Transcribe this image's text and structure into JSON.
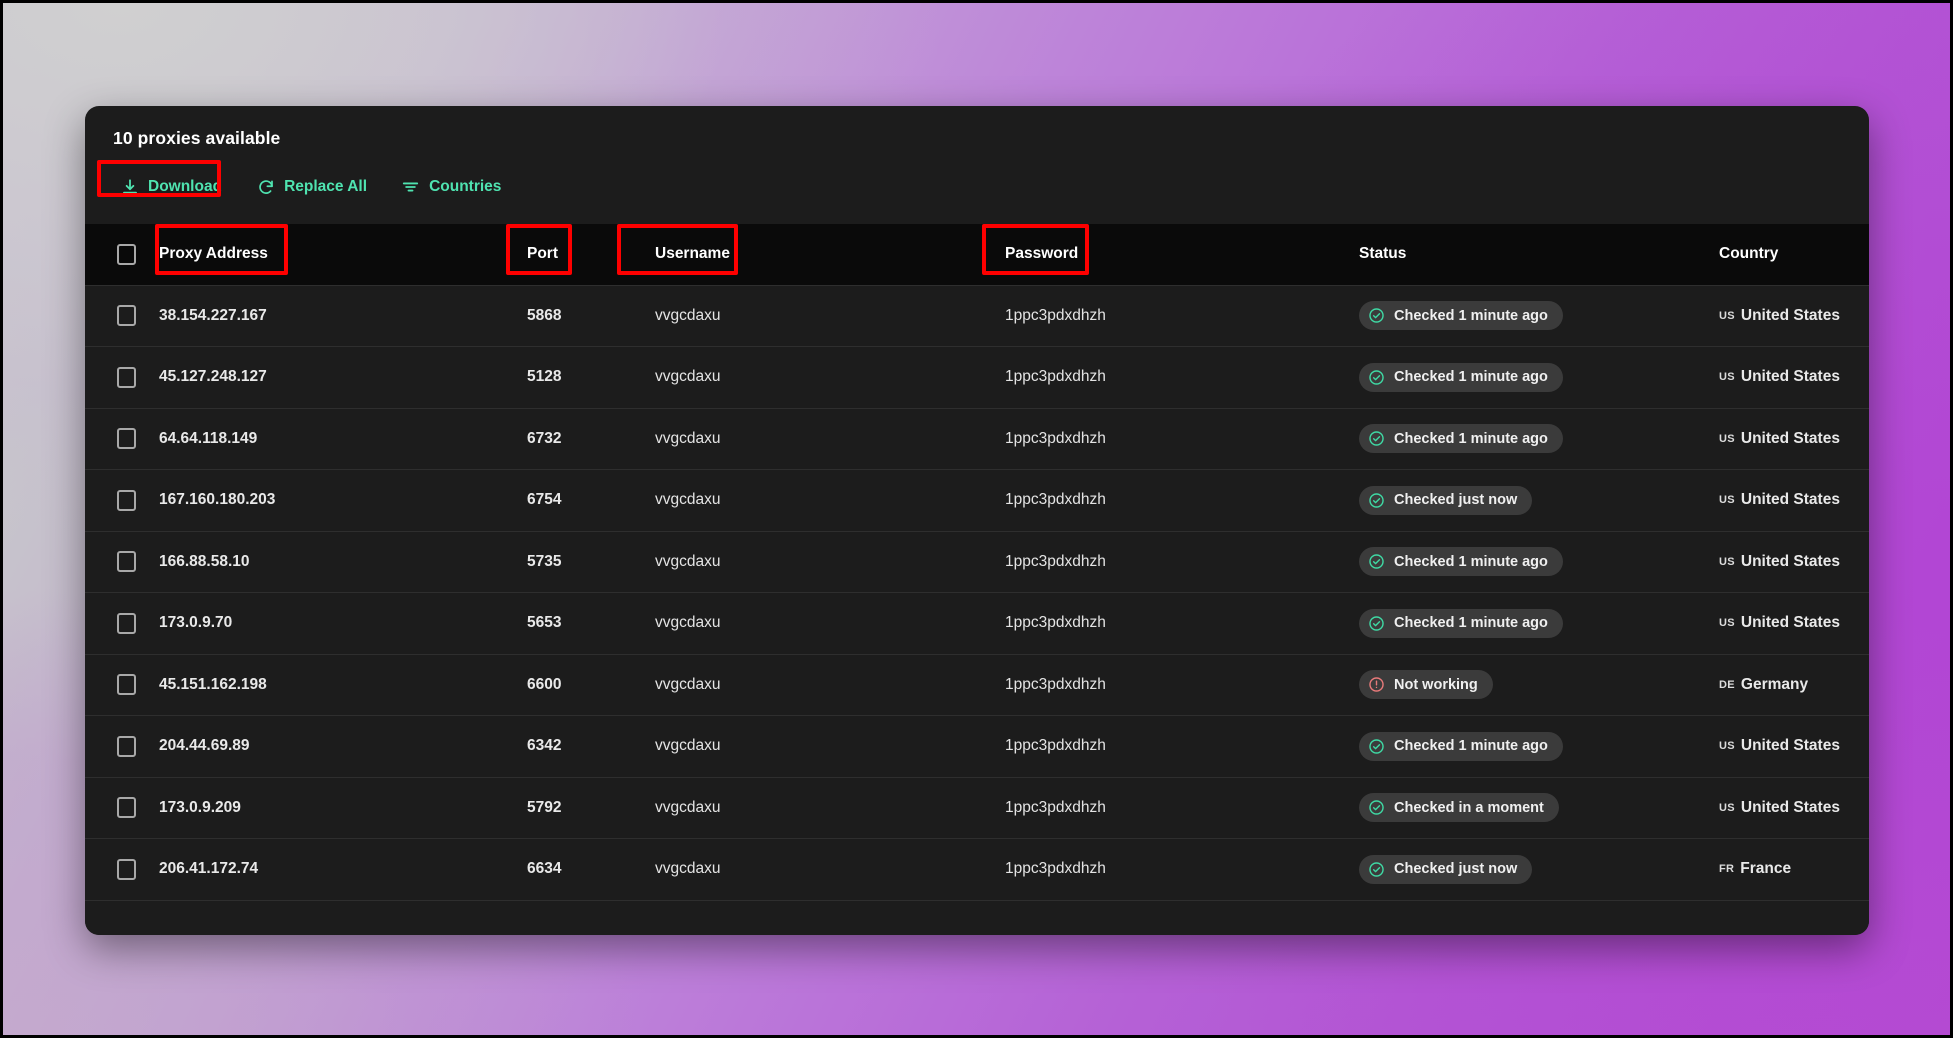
{
  "card": {
    "title": "10 proxies available",
    "toolbar": [
      {
        "label": "Download",
        "icon": "download-icon"
      },
      {
        "label": "Replace All",
        "icon": "refresh-icon"
      },
      {
        "label": "Countries",
        "icon": "filter-icon"
      }
    ]
  },
  "table": {
    "columns": [
      {
        "key": "address",
        "label": "Proxy Address",
        "highlighted": true
      },
      {
        "key": "port",
        "label": "Port",
        "highlighted": true
      },
      {
        "key": "username",
        "label": "Username",
        "highlighted": true
      },
      {
        "key": "password",
        "label": "Password",
        "highlighted": true
      },
      {
        "key": "status",
        "label": "Status",
        "highlighted": false
      },
      {
        "key": "country",
        "label": "Country",
        "highlighted": false
      }
    ],
    "rows": [
      {
        "address": "38.154.227.167",
        "port": "5868",
        "username": "vvgcdaxu",
        "password": "1ppc3pdxdhzh",
        "status": "Checked 1 minute ago",
        "status_state": "ok",
        "country_code": "us",
        "country": "United States"
      },
      {
        "address": "45.127.248.127",
        "port": "5128",
        "username": "vvgcdaxu",
        "password": "1ppc3pdxdhzh",
        "status": "Checked 1 minute ago",
        "status_state": "ok",
        "country_code": "us",
        "country": "United States"
      },
      {
        "address": "64.64.118.149",
        "port": "6732",
        "username": "vvgcdaxu",
        "password": "1ppc3pdxdhzh",
        "status": "Checked 1 minute ago",
        "status_state": "ok",
        "country_code": "us",
        "country": "United States"
      },
      {
        "address": "167.160.180.203",
        "port": "6754",
        "username": "vvgcdaxu",
        "password": "1ppc3pdxdhzh",
        "status": "Checked just now",
        "status_state": "ok",
        "country_code": "us",
        "country": "United States"
      },
      {
        "address": "166.88.58.10",
        "port": "5735",
        "username": "vvgcdaxu",
        "password": "1ppc3pdxdhzh",
        "status": "Checked 1 minute ago",
        "status_state": "ok",
        "country_code": "us",
        "country": "United States"
      },
      {
        "address": "173.0.9.70",
        "port": "5653",
        "username": "vvgcdaxu",
        "password": "1ppc3pdxdhzh",
        "status": "Checked 1 minute ago",
        "status_state": "ok",
        "country_code": "us",
        "country": "United States"
      },
      {
        "address": "45.151.162.198",
        "port": "6600",
        "username": "vvgcdaxu",
        "password": "1ppc3pdxdhzh",
        "status": "Not working",
        "status_state": "error",
        "country_code": "DE",
        "country": "Germany"
      },
      {
        "address": "204.44.69.89",
        "port": "6342",
        "username": "vvgcdaxu",
        "password": "1ppc3pdxdhzh",
        "status": "Checked 1 minute ago",
        "status_state": "ok",
        "country_code": "us",
        "country": "United States"
      },
      {
        "address": "173.0.9.209",
        "port": "5792",
        "username": "vvgcdaxu",
        "password": "1ppc3pdxdhzh",
        "status": "Checked in a moment",
        "status_state": "ok",
        "country_code": "us",
        "country": "United States"
      },
      {
        "address": "206.41.172.74",
        "port": "6634",
        "username": "vvgcdaxu",
        "password": "1ppc3pdxdhzh",
        "status": "Checked just now",
        "status_state": "ok",
        "country_code": "FR",
        "country": "France"
      }
    ]
  },
  "colors": {
    "accent": "#4fe3b0",
    "annotation": "#fe0000",
    "status_ok": "#3fd9a4",
    "status_error": "#e87a7a",
    "card_bg": "#1c1c1c",
    "header_bg": "#0a0a0a"
  }
}
